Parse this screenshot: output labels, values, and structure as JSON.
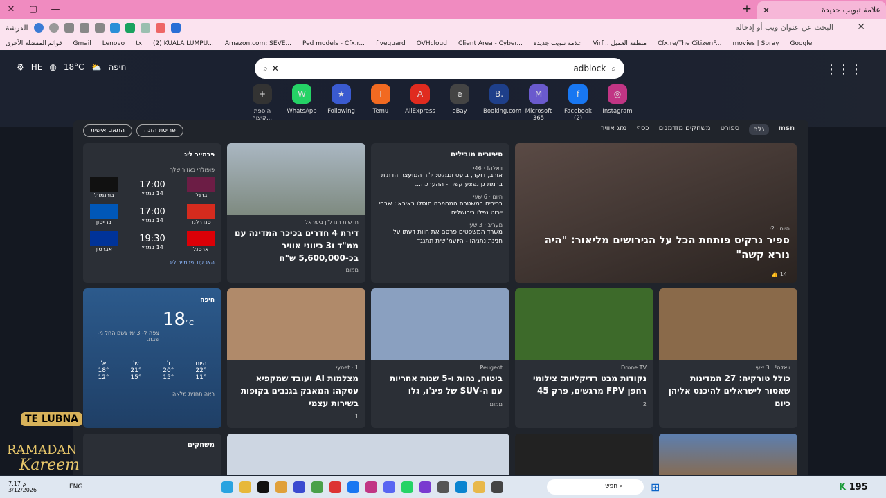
{
  "tab": {
    "title": "علامة تبويب جديدة"
  },
  "address": {
    "placeholder": "البحث عن عنوان ويب أو إدخاله"
  },
  "bookmarks": [
    "قوائم المفضلة الأخرى",
    "Gmail",
    "Lenovo",
    "tx",
    "(2) KUALA LUMPU...",
    "Amazon.com: SEVE...",
    "Ped models - Cfx.r...",
    "fiveguard",
    "OVHcloud",
    "Client Area - Cyber...",
    "علامة تبويب جديدة",
    "Virf... منطقة العميل",
    "Cfx.re/The CitizenF...",
    "movies | Spray",
    "Google"
  ],
  "profile": "الدرشة",
  "weather": {
    "city": "חיפה",
    "temp": "18°C",
    "lang": "HE"
  },
  "search": {
    "query": "adblock"
  },
  "tiles": [
    {
      "label": "הוספת קיצור...",
      "icon": "+"
    },
    {
      "label": "WhatsApp",
      "icon": "W"
    },
    {
      "label": "Following",
      "icon": "★"
    },
    {
      "label": "Temu",
      "icon": "T"
    },
    {
      "label": "AliExpress",
      "icon": "A"
    },
    {
      "label": "eBay",
      "icon": "e"
    },
    {
      "label": "Booking.com",
      "icon": "B."
    },
    {
      "label": "Microsoft 365",
      "icon": "M"
    },
    {
      "label": "Facebook (2)",
      "icon": "f"
    },
    {
      "label": "Instagram",
      "icon": "◎"
    }
  ],
  "nav": [
    "גלה",
    "ספורט",
    "משחקים מזדמנים",
    "כסף",
    "מזג אוויר"
  ],
  "buttons": {
    "personalize": "התאם אישית",
    "layout": "פריסת הזנה"
  },
  "hero": {
    "source": "היום · 2י",
    "title": "ספיר נרקיס פותחת הכל על הגירושים מליאור: \"היה נורא קשה\"",
    "likes": "14"
  },
  "trending": {
    "title": "סיפורים מובילים",
    "items": [
      {
        "src": "וואלה! · 46י",
        "text": "אורב, דוקר, בועט ונמלט: יו\"ר המועצה הדתית ברמת גן נפצע קשה - ההערכה..."
      },
      {
        "src": "היום · 6 שעי",
        "text": "בכירים במשטרת המהפכה חוסלו באיראן; שברי יירוט נפלו בירושלים"
      },
      {
        "src": "מעריב · 3 שעי",
        "text": "משרד המשפטים פרסם את חוות דעתו על חנינת נתניהו - היועמ\"שית תתנגד"
      }
    ]
  },
  "apt": {
    "src": "חדשות הנדל\"ן בישראל",
    "title": "דירת 4 חדרים בכיכר המדינה עם ממ\"ד ו3 כיווני אוויר בכ-5,600,000 ש\"ח",
    "tag": "ממומן"
  },
  "league": {
    "title": "פרמייר ליג",
    "sub": "פופולרי באזור שלך",
    "more": "הצג עוד פרמייר ליג",
    "matches": [
      {
        "home": "ברנלי",
        "away": "בורנמות'",
        "time": "17:00",
        "date": "14 במרץ"
      },
      {
        "home": "סנדרלנד",
        "away": "ברייטון",
        "time": "17:00",
        "date": "14 במרץ"
      },
      {
        "home": "ארסנל",
        "away": "אברטון",
        "time": "19:30",
        "date": "14 במרץ"
      }
    ]
  },
  "forecast": {
    "city": "חיפה",
    "temp": "18",
    "unit": "°C",
    "desc": "צפה ל- 3 ימי גשם החל מ- שבת.",
    "tabs": [
      "לפי שעות",
      "יומי"
    ],
    "days": [
      {
        "d": "היום",
        "h": "22°",
        "l": "11°"
      },
      {
        "d": "ו'",
        "h": "20°",
        "l": "15°"
      },
      {
        "d": "ש'",
        "h": "21°",
        "l": "15°"
      },
      {
        "d": "א'",
        "h": "18°",
        "l": "12°"
      }
    ],
    "more": "ראה תחזית מלאה"
  },
  "cards": [
    {
      "src": "וואלה! · 3 שעי",
      "title": "כולל טורקיה: 27 המדינות שאסור לישראלים להיכנס אליהן כיום"
    },
    {
      "src": "Drone TV",
      "title": "נקודות מבט רדיקליות: צילומי רחפן FPV מרגשים, פרק 45",
      "likes": "2"
    },
    {
      "src": "Peugeot",
      "title": "ביטוח, נחות ו-5 שנות אחריות עם ה-SUV של פיג'ו, גלו",
      "tag": "ממומן"
    },
    {
      "src": "ynet · 1י",
      "title": "מצלמות AI ועובד שמקפיא עסקה: המאבק בגנבים בקופות בשירות עצמי",
      "likes": "1"
    }
  ],
  "games": "משחקים",
  "taskbar": {
    "time": "7:17 م",
    "date": "3/12/2026",
    "lang": "ENG",
    "search": "חפש",
    "score": "195"
  },
  "promo": {
    "name": "TE LUBNA",
    "line1": "RAMADAN",
    "line2": "Kareem"
  }
}
